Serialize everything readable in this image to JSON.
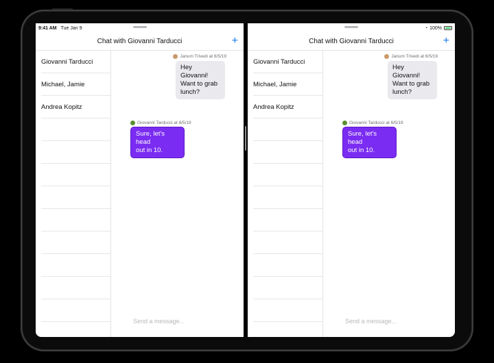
{
  "status": {
    "time": "9:41 AM",
    "date": "Tue Jan 9",
    "battery": "100%"
  },
  "left_pane": {
    "title": "Chat with Giovanni Tarducci",
    "add_label": "+",
    "conversations": [
      "Giovanni Tarducci",
      "Michael, Jamie",
      "Andrea Kopitz"
    ],
    "messages": [
      {
        "sender": "Janum Trivedi at 6/5/19",
        "text_lines": [
          "Hey Giovanni!",
          "Want to grab",
          "lunch?"
        ],
        "direction": "incoming"
      },
      {
        "sender": "Giovanni Tarducci at 6/5/19",
        "text_lines": [
          "Sure, let's head",
          "out in 10."
        ],
        "direction": "outgoing"
      }
    ],
    "compose_placeholder": "Send a message..."
  },
  "right_pane": {
    "title": "Chat with Giovanni Tarducci",
    "add_label": "+",
    "conversations": [
      "Giovanni Tarducci",
      "Michael, Jamie",
      "Andrea Kopitz"
    ],
    "messages": [
      {
        "sender": "Janum Trivedi at 6/5/19",
        "text_lines": [
          "Hey Giovanni!",
          "Want to grab",
          "lunch?"
        ],
        "direction": "incoming"
      },
      {
        "sender": "Giovanni Tarducci at 6/5/19",
        "text_lines": [
          "Sure, let's head",
          "out in 10."
        ],
        "direction": "outgoing"
      }
    ],
    "compose_placeholder": "Send a message..."
  },
  "colors": {
    "accent": "#1d7bf2",
    "outgoing_bubble": "#7b2cf2",
    "incoming_bubble": "#e9e9ee"
  },
  "icons": [
    "wifi-icon",
    "battery-icon",
    "plus-icon"
  ]
}
